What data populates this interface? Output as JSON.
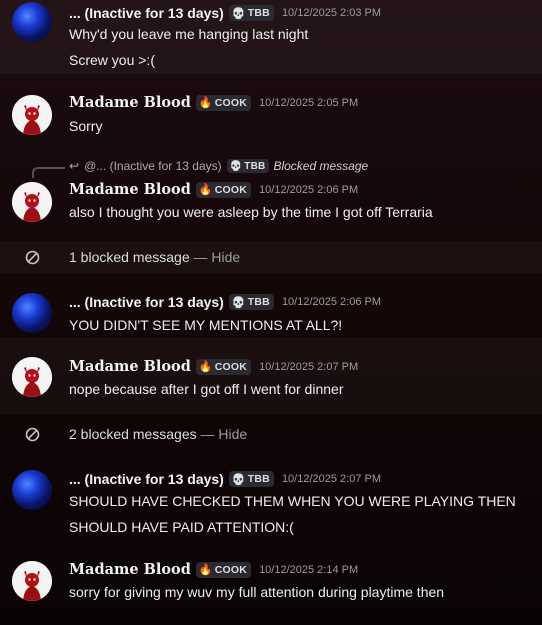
{
  "users": {
    "inactive": {
      "name": "... (Inactive for 13 days)",
      "tag": "TBB",
      "tag_icon": "skull-icon"
    },
    "madame": {
      "name": "Madame Blood",
      "tag": "COOK",
      "tag_icon": "fire-icon"
    }
  },
  "messages": [
    {
      "author": "inactive",
      "timestamp": "10/12/2025 2:03 PM",
      "lines": [
        "Why'd you leave me hanging last night",
        "Screw you >:("
      ]
    },
    {
      "author": "madame",
      "timestamp": "10/12/2025 2:05 PM",
      "lines": [
        "Sorry"
      ]
    },
    {
      "author": "madame",
      "timestamp": "10/12/2025 2:06 PM",
      "lines": [
        "also I thought you were asleep by the time I got off Terraria"
      ],
      "reply": {
        "name": "@... (Inactive for 13 days)",
        "tag": "TBB",
        "text": "Blocked message"
      }
    },
    {
      "author": "inactive",
      "timestamp": "10/12/2025 2:06 PM",
      "lines": [
        "YOU DIDN'T SEE MY MENTIONS AT ALL?!"
      ]
    },
    {
      "author": "madame",
      "timestamp": "10/12/2025 2:07 PM",
      "lines": [
        "nope because after I got off I went for dinner"
      ]
    },
    {
      "author": "inactive",
      "timestamp": "10/12/2025 2:07 PM",
      "lines": [
        "SHOULD HAVE CHECKED THEM WHEN YOU WERE PLAYING THEN",
        "SHOULD HAVE PAID ATTENTION:("
      ]
    },
    {
      "author": "madame",
      "timestamp": "10/12/2025 2:14 PM",
      "lines": [
        "sorry for giving my wuv my full attention during playtime then"
      ]
    }
  ],
  "blocked": [
    {
      "count_text": "1 blocked message",
      "sep": " — ",
      "action": "Hide"
    },
    {
      "count_text": "2 blocked messages",
      "sep": " — ",
      "action": "Hide"
    }
  ],
  "colors": {
    "background": "#140708",
    "timestamp": "#9a9ca3",
    "tag_bg": "#2b2a30"
  }
}
